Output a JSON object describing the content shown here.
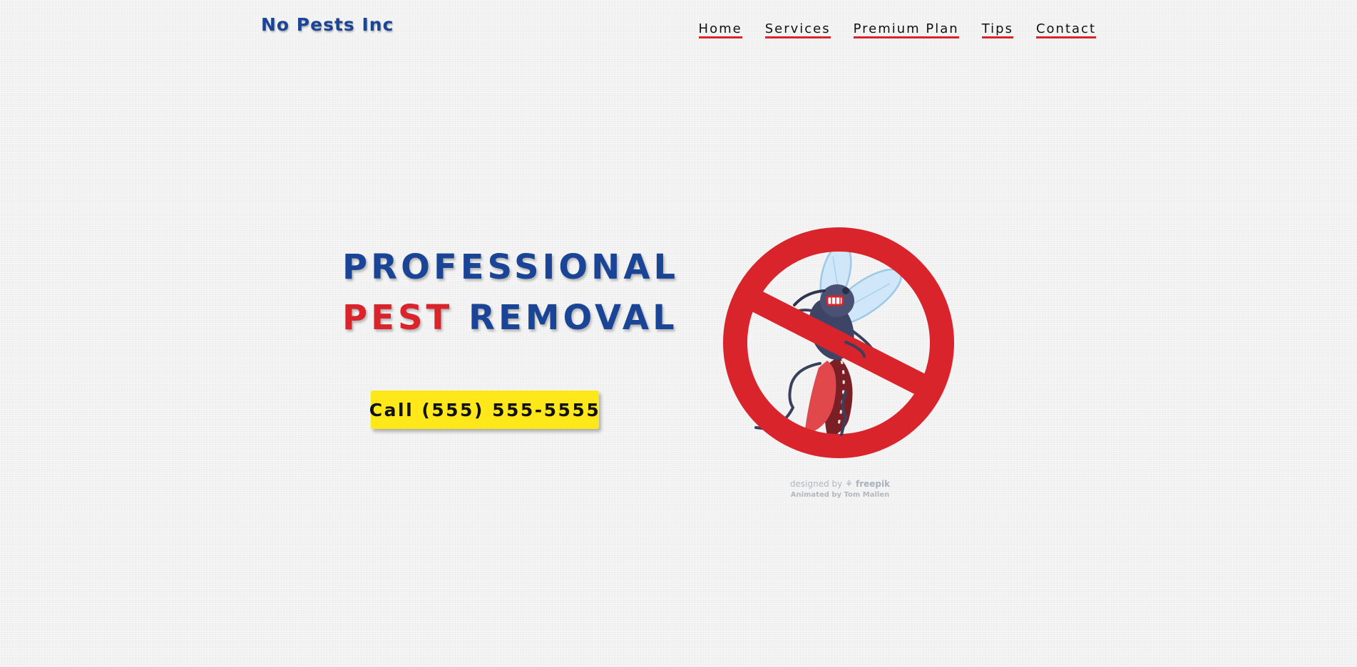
{
  "header": {
    "logo_text": "No Pests Inc",
    "nav": {
      "home": "Home",
      "services": "Services",
      "premium_plan": "Premium Plan",
      "tips": "Tips",
      "contact": "Contact"
    }
  },
  "hero": {
    "headline_line1": "PROFESSIONAL",
    "headline_line2_red": "PEST",
    "headline_line2_blue": "REMOVAL",
    "call_button_label": "Call (555) 555-5555"
  },
  "illustration": {
    "icon": "no-mosquito-icon"
  },
  "credits": {
    "designed_by": "designed by",
    "brand": "freepik",
    "animated_by": "Animated by Tom Mallen"
  },
  "colors": {
    "brand_blue": "#1a4496",
    "accent_red": "#d9242b",
    "button_yellow": "#ffe81a",
    "background": "#f3f3f3"
  }
}
